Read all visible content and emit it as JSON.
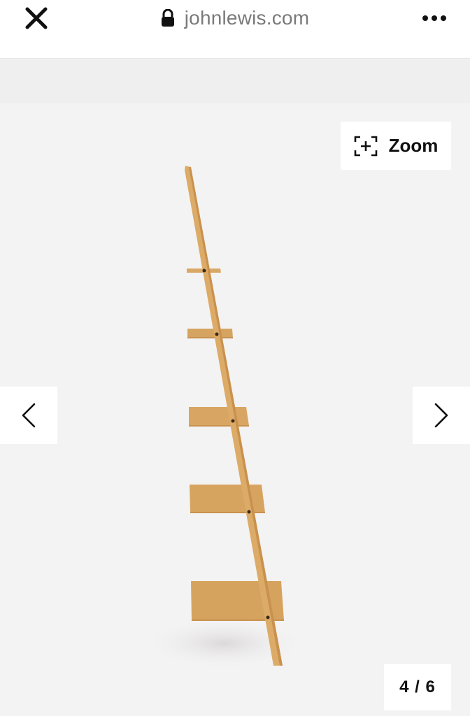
{
  "browser": {
    "url": "johnlewis.com",
    "icons": {
      "close": "close-icon",
      "lock": "lock-icon",
      "more": "more-options-icon"
    }
  },
  "gallery": {
    "zoom_label": "Zoom",
    "counter": "4 / 6",
    "current_index": 4,
    "total_images": 6,
    "image_subject": "wooden ladder shelf, side view",
    "icons": {
      "zoom": "zoom-icon",
      "prev": "chevron-left-icon",
      "next": "chevron-right-icon"
    }
  },
  "colors": {
    "wood": "#d9a866",
    "wood_dark": "#c48f4d",
    "background": "#f4f3f3",
    "text": "#111111",
    "url_text": "#7a7a7a"
  }
}
